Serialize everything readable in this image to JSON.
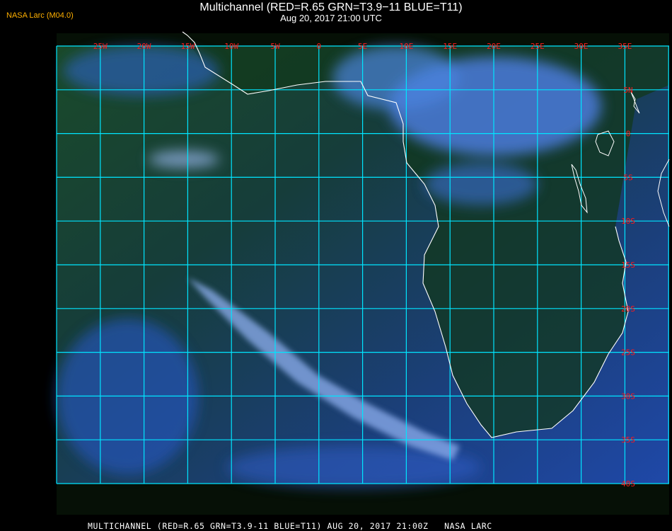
{
  "header": {
    "tag": "NASA Larc (M04.0)",
    "title": "Multichannel (RED=R.65 GRN=T3.9−11 BLUE=T11)",
    "datetime": "Aug 20, 2017 21:00 UTC"
  },
  "map": {
    "lon_labels": [
      "25W",
      "20W",
      "15W",
      "10W",
      "5W",
      "0",
      "5E",
      "10E",
      "15E",
      "20E",
      "25E",
      "30E",
      "35E"
    ],
    "lat_labels": [
      "5N",
      "0",
      "5S",
      "10S",
      "15S",
      "20S",
      "25S",
      "30S",
      "35S",
      "40S"
    ],
    "grid_color": "#00e5ff",
    "label_color": "#ff1a1a",
    "coast_color": "#ffffff"
  },
  "footer": {
    "caption": "MULTICHANNEL (RED=R.65 GRN=T3.9-11 BLUE=T11) AUG 20, 2017 21:00Z   NASA LARC"
  }
}
